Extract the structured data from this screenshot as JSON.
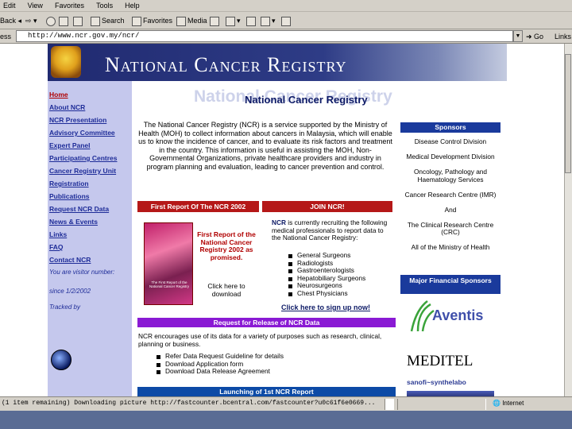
{
  "browser": {
    "menu": [
      "Edit",
      "View",
      "Favorites",
      "Tools",
      "Help"
    ],
    "toolbar": {
      "back": "Back",
      "search": "Search",
      "favorites": "Favorites",
      "media": "Media"
    },
    "address_label": "ess",
    "address_value": "http://www.ncr.gov.my/ncr/",
    "go_label": "Go",
    "links_label": "Links"
  },
  "page": {
    "banner_title": "National Cancer Registry",
    "nav": [
      "Home",
      "About NCR",
      "NCR Presentation",
      "Advisory Committee",
      "Expert Panel",
      "Participating Centres",
      "Cancer Registry Unit",
      "Registration",
      "Publications",
      "Request NCR Data",
      "News & Events",
      "Links",
      "FAQ",
      "Contact NCR"
    ],
    "visitor_text": "You are visitor number:",
    "since_text": "since 1/2/2002",
    "tracked_text": "Tracked by",
    "watermark": "National Cancer Registry",
    "main_title": "National Cancer Registry",
    "intro": "The National Cancer Registry (NCR) is a service supported by the Ministry of Health (MOH) to collect information about cancers in Malaysia, which will enable us to know the incidence of cancer, and to evaluate its risk factors and treatment in the country. This information is useful in assisting the MOH, Non-Governmental Organizations, private healthcare providers and industry in program planning and evaluation, leading to cancer prevention and control.",
    "sponsors_header": "Sponsors",
    "sponsors_text": "Disease Control Division\n\nMedical Development Division\n\nOncology, Pathology and Haematology Services\n\nCancer Research Centre (IMR)\n\nAnd\n\nThe Clinical Research Centre (CRC)\n\nAll of the Ministry of Health",
    "financial_header": "Major Financial Sponsors",
    "sponsor_logos": [
      "Aventis",
      "MEDITEL",
      "sanofi~synthelabo"
    ],
    "first_report_bar": "First Report Of The NCR 2002",
    "join_bar": "JOIN NCR!",
    "report_cover_text": "The First Report of the National Cancer Registry",
    "first_report_text": "First Report of the National Cancer Registry 2002 as promised.",
    "first_report_click": "Click here to download",
    "ncr_lead": "NCR",
    "ncr_text": " is currently recruiting the following medical professionals to report data to the National Cancer Registry:",
    "ncr_list": [
      "General Surgeons",
      "Radiologists",
      "Gastroenterologists",
      "Hepatobiliary Surgeons",
      "Neurosurgeons",
      "Chest Physicians"
    ],
    "signup": "Click here to sign up now!",
    "release_bar": "Request for Release of NCR Data",
    "release_text": "NCR encourages use of its data for a variety of purposes such as research, clinical, planning or business.",
    "release_list": [
      "Refer Data Request Guideline for details",
      "Download Application form",
      "Download Data Release Agreement"
    ],
    "launch_bar": "Launching of 1st NCR Report"
  },
  "status": {
    "text": "(1 item remaining) Downloading picture http://fastcounter.bcentral.com/fastcounter?u0c61f6e0669...",
    "zone": "Internet"
  },
  "colors": {
    "banner": "#202a70",
    "nav_bg": "#c5c8ed",
    "red_bar": "#b51818",
    "purple_bar": "#8a1ad4",
    "blue_bar": "#0c4aa6",
    "sponsor_head": "#1a3a9c"
  }
}
